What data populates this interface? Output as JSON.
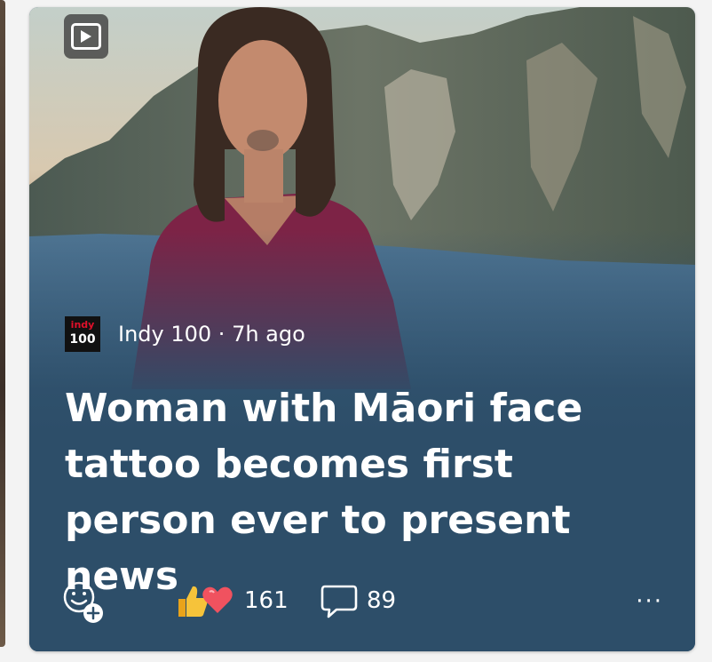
{
  "card": {
    "media_type_icon": "video-play-icon",
    "source": {
      "logo_line1": "indy",
      "logo_line2": "100",
      "name": "Indy 100",
      "separator": " · ",
      "time": "7h ago"
    },
    "headline": "Woman with Māori face tattoo becomes first person ever to present news",
    "actions": {
      "react_icon": "smiley-add-icon",
      "reaction_icons": [
        "thumbs-up-icon",
        "heart-icon"
      ],
      "reaction_count": "161",
      "comment_icon": "speech-bubble-icon",
      "comment_count": "89",
      "more_label": "···"
    }
  },
  "colors": {
    "card_background": "#2d4e69",
    "text": "#ffffff",
    "logo_red": "#e0102a"
  }
}
